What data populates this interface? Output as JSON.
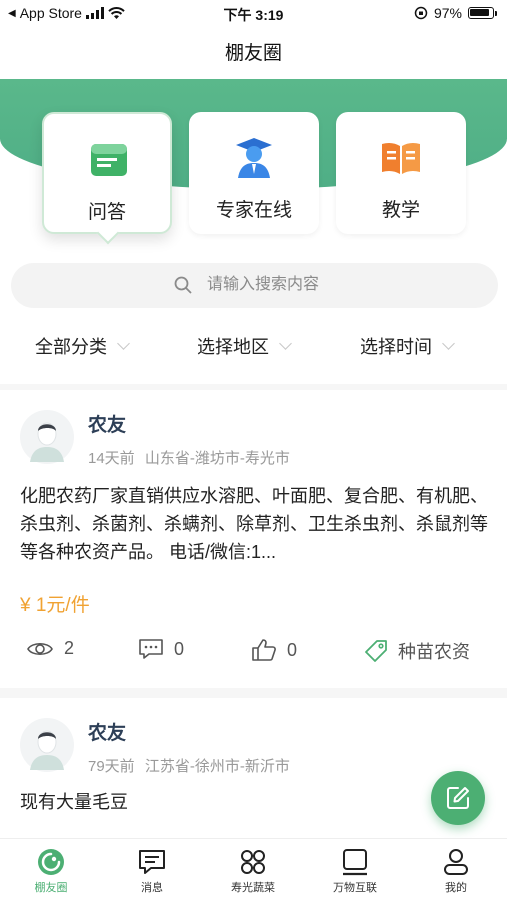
{
  "status_bar": {
    "back_label": "App Store",
    "time": "下午 3:19",
    "battery": "97%"
  },
  "nav": {
    "title": "棚友圈"
  },
  "categories": [
    {
      "label": "问答",
      "icon": "qa-doc-icon",
      "active": true
    },
    {
      "label": "专家在线",
      "icon": "expert-icon",
      "active": false
    },
    {
      "label": "教学",
      "icon": "book-icon",
      "active": false
    }
  ],
  "search": {
    "placeholder": "请输入搜索内容"
  },
  "filters": [
    {
      "label": "全部分类"
    },
    {
      "label": "选择地区"
    },
    {
      "label": "选择时间"
    }
  ],
  "posts": [
    {
      "author": "农友",
      "time_ago": "14天前",
      "location": "山东省-潍坊市-寿光市",
      "body": "化肥农药厂家直销供应水溶肥、叶面肥、复合肥、有机肥、杀虫剂、杀菌剂、杀螨剂、除草剂、卫生杀虫剂、杀鼠剂等等各种农资产品。 电话/微信:1...",
      "price": "¥ 1元/件",
      "views": "2",
      "comments": "0",
      "likes": "0",
      "tag": "种苗农资"
    },
    {
      "author": "农友",
      "time_ago": "79天前",
      "location": "江苏省-徐州市-新沂市",
      "body": "现有大量毛豆"
    }
  ],
  "tabbar": [
    {
      "label": "棚友圈",
      "icon": "community-icon",
      "active": true
    },
    {
      "label": "消息",
      "icon": "message-icon",
      "active": false
    },
    {
      "label": "寿光蔬菜",
      "icon": "grid-icon",
      "active": false
    },
    {
      "label": "万物互联",
      "icon": "monitor-icon",
      "active": false
    },
    {
      "label": "我的",
      "icon": "user-icon",
      "active": false
    }
  ],
  "colors": {
    "brand": "#4caf73",
    "price": "#f0a232",
    "header_green": "#5ab88b"
  }
}
